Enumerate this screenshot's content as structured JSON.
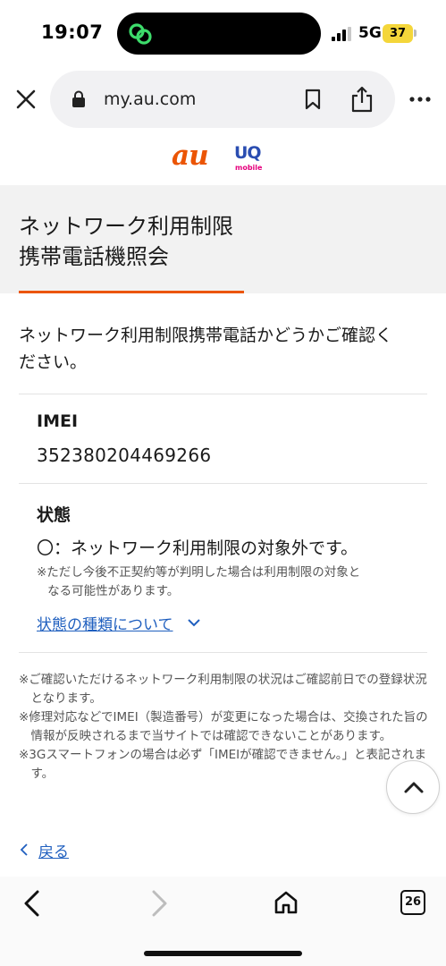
{
  "status_bar": {
    "time": "19:07",
    "network": "5G",
    "battery": "37",
    "icons": [
      "signal-icon",
      "link-activity-icon"
    ]
  },
  "browser": {
    "url": "my.au.com",
    "icons": [
      "close-icon",
      "lock-icon",
      "bookmark-icon",
      "share-icon",
      "more-icon"
    ]
  },
  "logos": {
    "au": "au",
    "uq_main": "UQ",
    "uq_sub": "mobile"
  },
  "page": {
    "title_line1": "ネットワーク利用制限",
    "title_line2": "携帯電話機照会",
    "intro_line1": "ネットワーク利用制限携帯電話かどうかご確認く",
    "intro_line2": "ださい。",
    "imei_label": "IMEI",
    "imei_value": "352380204469266",
    "state_label": "状態",
    "state_value": "〇：ネットワーク利用制限の対象外です。",
    "state_note_line1": "※ただし今後不正契約等が判明した場合は利用制限の対象と",
    "state_note_line2": "なる可能性があります。",
    "types_link": "状態の種類について",
    "notes": [
      "※ご確認いただけるネットワーク利用制限の状況はご確認前日での登録状況となります。",
      "※修理対応などでIMEI（製造番号）が変更になった場合は、交換された旨の情報が反映されるまで当サイトでは確認できないことがあります。",
      "※3Gスマートフォンの場合は必ず「IMEIが確認できません。」と表記されます。"
    ],
    "back_label": "戻る"
  },
  "toolbar": {
    "tab_count": "26",
    "icons": [
      "back-icon",
      "forward-icon",
      "home-icon",
      "tabs-icon"
    ]
  },
  "colors": {
    "accent": "#eb5505",
    "link": "#1f5fbf",
    "uq_blue": "#2a4db1",
    "uq_pink": "#e6007e"
  }
}
